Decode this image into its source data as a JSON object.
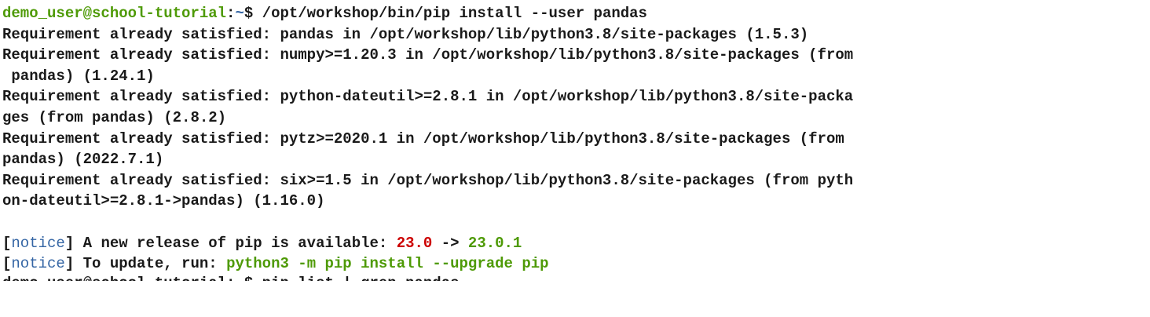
{
  "terminal": {
    "colors": {
      "prompt_user": "#4e9a06",
      "prompt_path": "#3465a4",
      "notice_tag": "#3465a4",
      "old_version": "#cc0000",
      "new_version": "#4e9a06",
      "text": "#1a1a1a",
      "background": "#ffffff"
    },
    "prompt": {
      "user_host": "demo_user@school-tutorial",
      "colon": ":",
      "path": "~",
      "symbol": "$ ",
      "command": "/opt/workshop/bin/pip install --user pandas"
    },
    "output": [
      "Requirement already satisfied: pandas in /opt/workshop/lib/python3.8/site-packages (1.5.3)",
      "Requirement already satisfied: numpy>=1.20.3 in /opt/workshop/lib/python3.8/site-packages (from",
      " pandas) (1.24.1)",
      "Requirement already satisfied: python-dateutil>=2.8.1 in /opt/workshop/lib/python3.8/site-packa",
      "ges (from pandas) (2.8.2)",
      "Requirement already satisfied: pytz>=2020.1 in /opt/workshop/lib/python3.8/site-packages (from ",
      "pandas) (2022.7.1)",
      "Requirement already satisfied: six>=1.5 in /opt/workshop/lib/python3.8/site-packages (from pyth",
      "on-dateutil>=2.8.1->pandas) (1.16.0)",
      ""
    ],
    "notice1": {
      "bracket_open": "[",
      "tag": "notice",
      "bracket_close": "]",
      "text": " A new release of pip is available: ",
      "old_version": "23.0",
      "arrow": " -> ",
      "new_version": "23.0.1"
    },
    "notice2": {
      "bracket_open": "[",
      "tag": "notice",
      "bracket_close": "]",
      "text": " To update, run: ",
      "command": "python3 -m pip install --upgrade pip"
    },
    "partial_line": "demo_user@school-tutorial:~$ pip list | grep pandas"
  }
}
